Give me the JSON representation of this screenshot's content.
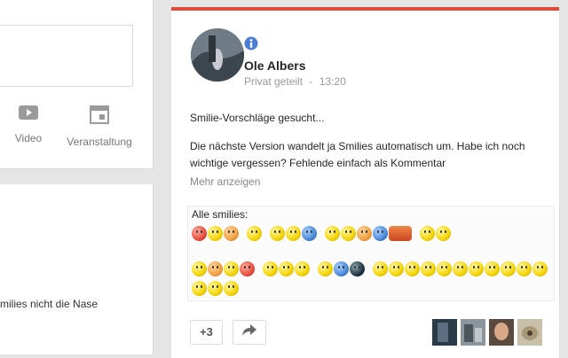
{
  "share_box": {
    "actions": [
      {
        "label": "Video",
        "icon": "video-icon"
      },
      {
        "label": "Veranstaltung",
        "icon": "event-icon"
      }
    ]
  },
  "left_snippet": "milies nicht die Nase",
  "post": {
    "author": "Ole Albers",
    "visibility": "Privat geteilt",
    "separator": "-",
    "time": "13:20",
    "title_line": "Smilie-Vorschläge gesucht...",
    "body": "Die nächste Version wandelt ja Smilies automatisch um. Habe ich noch wichtige vergessen? Fehlende einfach als Kommentar",
    "more_label": "Mehr anzeigen",
    "embed_label": "Alle smilies:",
    "plus_count": "+3",
    "accent_color": "#dd4b39",
    "icons": {
      "info": "info-icon",
      "share": "share-icon"
    }
  }
}
